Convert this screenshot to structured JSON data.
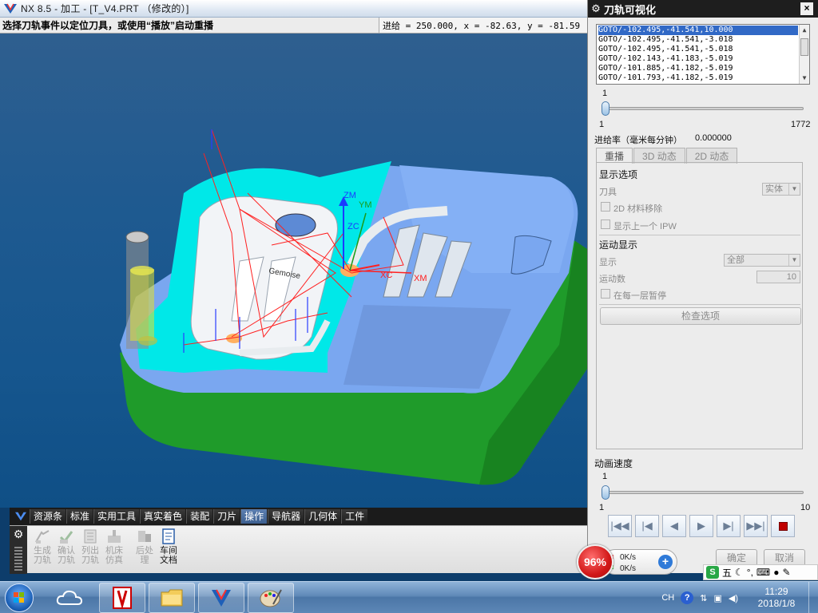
{
  "window": {
    "title": "NX 8.5 - 加工 - [T_V4.PRT （修改的）]",
    "cue": "选择刀轨事件以定位刀具，或使用“播放”启动重播",
    "status": "进给 = 250.000, x = -82.63, y = -81.59"
  },
  "viewport": {
    "axis_zm": "ZM",
    "axis_zc": "ZC",
    "axis_ym": "YM",
    "axis_xc": "XC",
    "axis_xm": "XM"
  },
  "resource_tabs": [
    "资源条",
    "标准",
    "实用工具",
    "真实着色",
    "装配",
    "刀片",
    "操作",
    "导航器",
    "几何体",
    "工件"
  ],
  "active_resource_tab": "操作",
  "toolbar": {
    "generate": [
      "生成",
      "刀轨"
    ],
    "verify": [
      "确认",
      "刀轨"
    ],
    "list": [
      "列出",
      "刀轨"
    ],
    "simulate": [
      "机床",
      "仿真"
    ],
    "postprocess": [
      "后处",
      "理"
    ],
    "shopdoc": [
      "车间",
      "文档"
    ]
  },
  "dialog": {
    "title": "刀轨可视化",
    "close": "×",
    "gotos": [
      "GOTO/-102.495,-41.541,10.000",
      "GOTO/-102.495,-41.541,-3.018",
      "GOTO/-102.495,-41.541,-5.018",
      "GOTO/-102.143,-41.183,-5.019",
      "GOTO/-101.885,-41.182,-5.019",
      "GOTO/-101.793,-41.182,-5.019"
    ],
    "slider1_value": "1",
    "slider1_min": "1",
    "slider1_max": "1772",
    "feedrate_label": "进给率（毫米每分钟）",
    "feedrate_value": "0.000000",
    "tabs": [
      "重播",
      "3D 动态",
      "2D 动态"
    ],
    "display_options": "显示选项",
    "tool_label": "刀具",
    "tool_value": "实体",
    "chk_2d_removal": "2D 材料移除",
    "chk_prev_ipw": "显示上一个 IPW",
    "motion_display": "运动显示",
    "display_label": "显示",
    "display_value": "全部",
    "motion_count_label": "运动数",
    "motion_count_value": "10",
    "chk_pause_layer": "在每一层暂停",
    "check_options": "检查选项",
    "anim_speed_label": "动画速度",
    "slider2_value": "1",
    "slider2_min": "1",
    "slider2_max": "10",
    "ok": "确定",
    "cancel": "取消"
  },
  "netspeed": {
    "percent": "96%",
    "up": "0K/s",
    "down": "0K/s"
  },
  "ime": {
    "mode": "五"
  },
  "taskbar": {
    "lang": "CH",
    "time": "11:29",
    "date": "2018/1/8"
  },
  "colors": {
    "cavity_face": "#00e8e8",
    "body_blue": "#7aa7f0",
    "side_green": "#1f9b2a",
    "toolpath": "#ff2020"
  }
}
